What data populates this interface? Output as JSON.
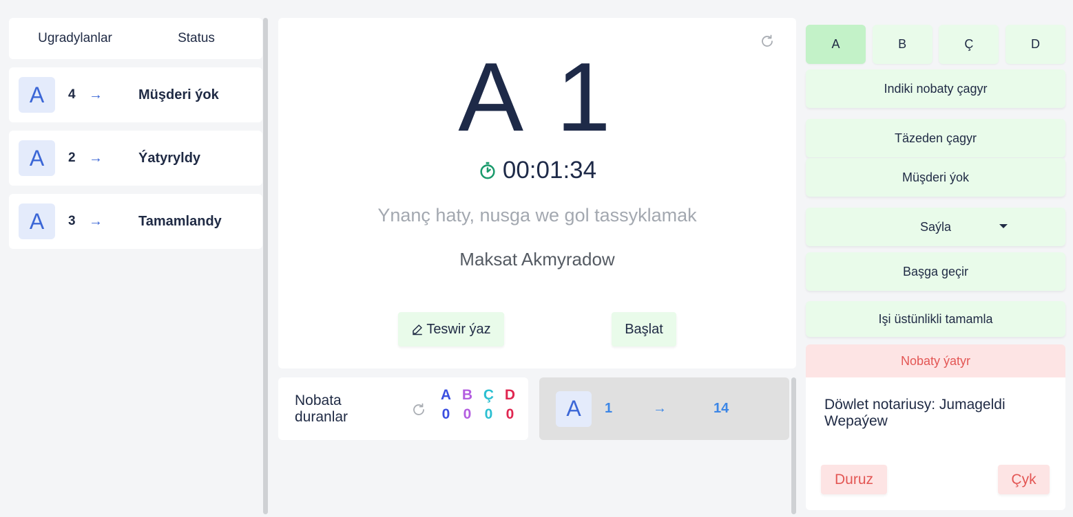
{
  "visited": {
    "col_visited": "Ugradylanlar",
    "col_status": "Status",
    "rows": [
      {
        "letter": "A",
        "number": "4",
        "arrow": "→",
        "status": "Müşderi ýok"
      },
      {
        "letter": "A",
        "number": "2",
        "arrow": "→",
        "status": "Ýatyryldy"
      },
      {
        "letter": "A",
        "number": "3",
        "arrow": "→",
        "status": "Tamamlandy"
      }
    ]
  },
  "current_ticket": {
    "ticket": "A 1",
    "timer": "00:01:34",
    "service": "Ynanç haty, nusga we gol tassyklamak",
    "person": "Maksat Akmyradow",
    "note_button": "Teswir ýaz",
    "start_button": "Başlat"
  },
  "waiting": {
    "label": "Nobata duranlar",
    "letters": [
      "A",
      "B",
      "Ç",
      "D"
    ],
    "counts": [
      "0",
      "0",
      "0",
      "0"
    ],
    "colors": [
      "#3b4fe0",
      "#b35de0",
      "#2bbfd1",
      "#e02650"
    ]
  },
  "transfer": {
    "letter": "A",
    "from": "1",
    "arrow": "→",
    "to": "14"
  },
  "controls": {
    "tabs": [
      "A",
      "B",
      "Ç",
      "D"
    ],
    "active_tab": "A",
    "call_next": "Indiki nobaty çagyr",
    "recall": "Täzeden çagyr",
    "no_customer": "Müşderi ýok",
    "select": "Saýla",
    "transfer": "Başga geçir",
    "complete_priority": "Işi üstünlikli tamamla",
    "cancel_queue": "Nobaty ýatyr"
  },
  "notary": {
    "text": "Döwlet notariusy: Jumageldi Wepaýew",
    "pause": "Duruz",
    "exit": "Çyk"
  }
}
